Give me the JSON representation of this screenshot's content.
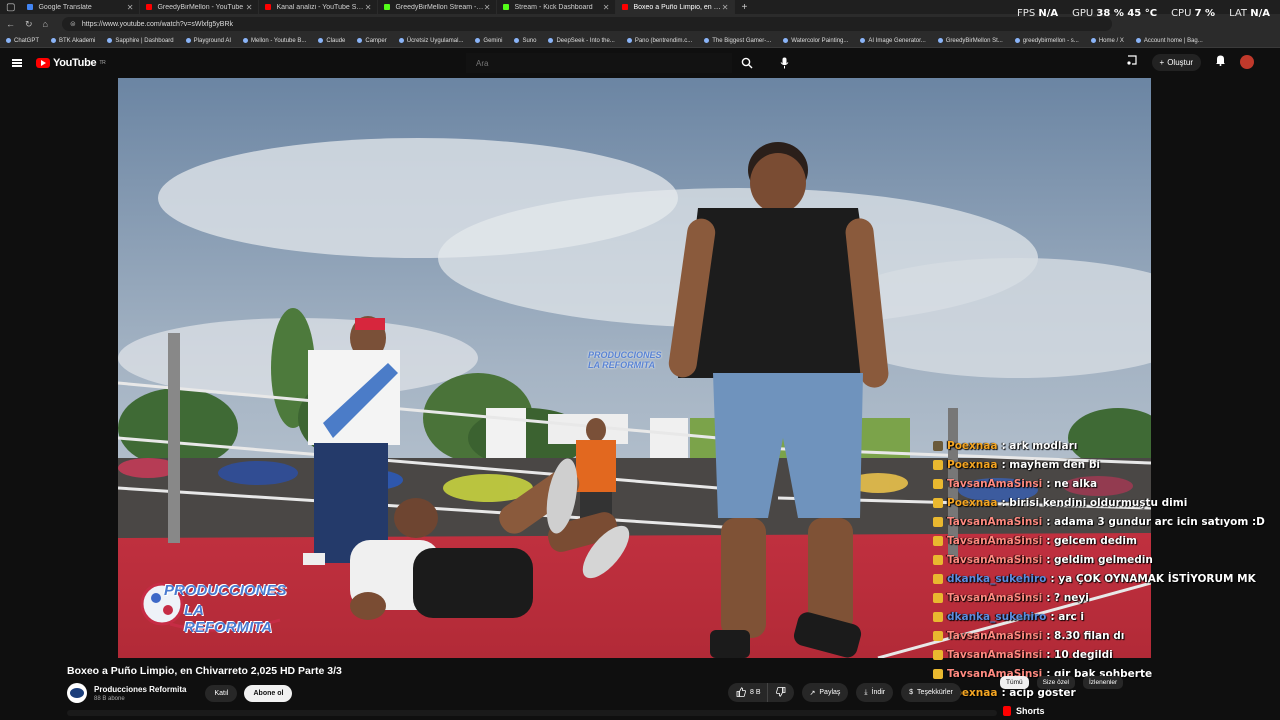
{
  "browser": {
    "tabs": [
      {
        "label": "Google Translate",
        "color": "#4285f4",
        "active": false
      },
      {
        "label": "GreedyBirMellon - YouTube",
        "color": "#ff0000",
        "active": false
      },
      {
        "label": "Kanal analizi - YouTube Studio",
        "color": "#ff0000",
        "active": false
      },
      {
        "label": "GreedyBirMellon Stream - Watch",
        "color": "#53fc18",
        "active": false
      },
      {
        "label": "Stream - Kick Dashboard",
        "color": "#53fc18",
        "active": false
      },
      {
        "label": "Boxeo a Puño Limpio, en Ch",
        "color": "#ff0000",
        "active": true
      }
    ],
    "url": "https://www.youtube.com/watch?v=sWlxfg5yBRk",
    "bookmarks": [
      "ChatGPT",
      "BTK Akademi",
      "Sapphire | Dashboard",
      "Playground AI",
      "Mellon - Youtube B...",
      "Claude",
      "Camper",
      "Ücretsiz Uygulamal...",
      "Gemini",
      "Suno",
      "DeepSeek - Into the...",
      "Pano (bentrendim.c...",
      "The Biggest Gamer-...",
      "Watercolor Painting...",
      "AI Image Generator...",
      "GreedyBirMellon St...",
      "greedybirmellon - s...",
      "Home / X",
      "Account home | Bag..."
    ]
  },
  "overlay": {
    "fps_label": "FPS",
    "fps_value": "N/A",
    "gpu_label": "GPU",
    "gpu_value": "38 %  45 °C",
    "cpu_label": "CPU",
    "cpu_value": "7 %",
    "lat_label": "LAT",
    "lat_value": "N/A"
  },
  "header": {
    "logo": "YouTube",
    "logo_region": "TR",
    "search_placeholder": "Ara",
    "create_label": "Oluştur"
  },
  "chat": [
    {
      "user": "Poexnaa",
      "msg": ": ark modları",
      "color": "#f5a623",
      "icon": "#6b5a3a"
    },
    {
      "user": "Poexnaa",
      "msg": ": mayhem den bi",
      "color": "#f5a623",
      "icon": "#e9b82f"
    },
    {
      "user": "TavsanAmaSinsi",
      "msg": ": ne alka",
      "color": "#ff8a80",
      "icon": "#e9b82f"
    },
    {
      "user": "Poexnaa",
      "msg": ": birisi kendini oldurmuştu dimi",
      "color": "#f5a623",
      "icon": "#e9b82f"
    },
    {
      "user": "TavsanAmaSinsi",
      "msg": ": adama 3 gundur arc icin satıyom :D",
      "color": "#ff8a80",
      "icon": "#e9b82f"
    },
    {
      "user": "TavsanAmaSinsi",
      "msg": ": gelcem dedim",
      "color": "#ff8a80",
      "icon": "#e9b82f"
    },
    {
      "user": "TavsanAmaSinsi",
      "msg": ": geldim gelmedin",
      "color": "#ff8a80",
      "icon": "#e9b82f"
    },
    {
      "user": "dkanka_sukehiro",
      "msg": ": ya ÇOK OYNAMAK İSTİYORUM MK",
      "color": "#5c8de0",
      "icon": "#e9b82f"
    },
    {
      "user": "TavsanAmaSinsi",
      "msg": ": ? neyi",
      "color": "#ff8a80",
      "icon": "#e9b82f"
    },
    {
      "user": "dkanka_sukehiro",
      "msg": ": arc i",
      "color": "#5c8de0",
      "icon": "#e9b82f"
    },
    {
      "user": "TavsanAmaSinsi",
      "msg": ": 8.30 filan dı",
      "color": "#ff8a80",
      "icon": "#e9b82f"
    },
    {
      "user": "TavsanAmaSinsi",
      "msg": ": 10 degildi",
      "color": "#ff8a80",
      "icon": "#e9b82f"
    },
    {
      "user": "TavsanAmaSinsi",
      "msg": ": gir bak sohberte",
      "color": "#ff8a80",
      "icon": "#e9b82f"
    },
    {
      "user": "Poexnaa",
      "msg": ": acip göster",
      "color": "#f5a623",
      "icon": "#e9b82f"
    }
  ],
  "video": {
    "watermark_line1": "PRODUCCIONES",
    "watermark_line2": "LA REFORMITA",
    "title": "Boxeo a Puño Limpio, en Chivarreto 2,025 HD Parte 3/3",
    "channel_name": "Producciones  Reformita",
    "channel_subs": "88 B abone",
    "join_label": "Katıl",
    "subscribe_label": "Abone ol",
    "like_count": "8 B",
    "share_label": "Paylaş",
    "download_label": "İndir",
    "thanks_label": "Teşekkürler"
  },
  "sidebar": {
    "chips": [
      "Tümü",
      "Size özel",
      "İzlenenler"
    ],
    "shorts_label": "Shorts"
  }
}
